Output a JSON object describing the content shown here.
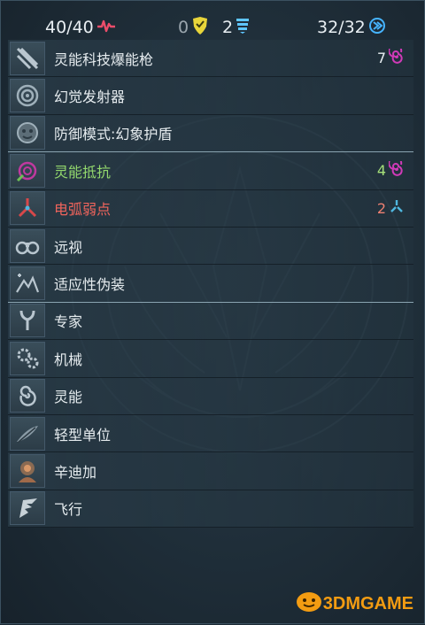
{
  "header": {
    "hp": "40/40",
    "shield": "0",
    "armor": "2",
    "energy": "32/32",
    "hp_icon": "heartbeat-icon",
    "shield_icon": "shield-icon",
    "armor_icon": "armor-stack-icon",
    "energy_icon": "energy-chevron-icon"
  },
  "rows": [
    {
      "label": "灵能科技爆能枪",
      "count": "7",
      "icon": "psionic-blaster-icon",
      "count_icon": "psionic-swirl-icon"
    },
    {
      "label": "幻觉发射器",
      "icon": "hallucination-emitter-icon"
    },
    {
      "label": "防御模式:幻象护盾",
      "icon": "phantom-shield-icon"
    },
    {
      "label": "灵能抵抗",
      "count": "4",
      "icon": "psionic-resist-icon",
      "count_icon": "psionic-swirl-icon"
    },
    {
      "label": "电弧弱点",
      "count": "2",
      "icon": "arc-weakness-icon",
      "count_icon": "arc-icon"
    },
    {
      "label": "远视",
      "icon": "binoculars-icon"
    },
    {
      "label": "适应性伪装",
      "icon": "camouflage-icon"
    },
    {
      "label": "专家",
      "icon": "specialist-icon"
    },
    {
      "label": "机械",
      "icon": "gears-icon"
    },
    {
      "label": "灵能",
      "icon": "psionic-icon"
    },
    {
      "label": "轻型单位",
      "icon": "feather-icon"
    },
    {
      "label": "辛迪加",
      "icon": "syndicate-icon"
    },
    {
      "label": "飞行",
      "icon": "wing-icon"
    }
  ],
  "colors": {
    "accent_green": "#93d86d",
    "accent_red": "#f0645c",
    "energy_blue": "#46b4ff",
    "shield_yellow": "#e8d53a",
    "swirl_magenta": "#d03ab8"
  },
  "watermark": {
    "brand": "3DMGAME"
  }
}
